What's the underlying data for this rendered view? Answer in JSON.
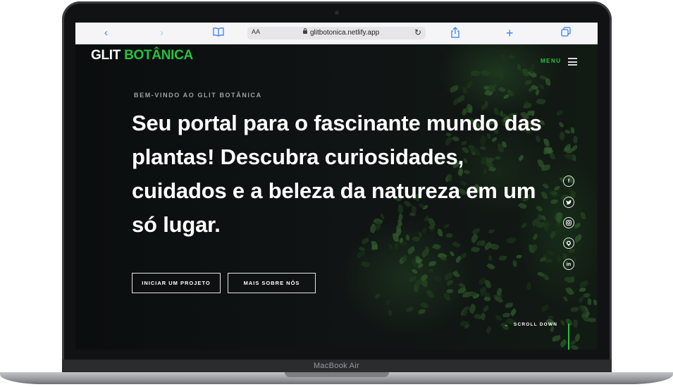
{
  "device": {
    "label": "MacBook Air"
  },
  "browser": {
    "url": "glitbotonica.netlify.app",
    "text_size_label": "AA",
    "icons": [
      "back-icon",
      "forward-icon",
      "bookmarks-icon",
      "reload-icon",
      "share-icon",
      "new-tab-icon",
      "tabs-icon"
    ]
  },
  "site": {
    "brand_main": "GLIT",
    "brand_accent": "BOTÂNICA",
    "menu_label": "MENU",
    "eyebrow": "BEM-VINDO AO GLIT BOTÂNICA",
    "headline": "Seu portal para o fascinante mundo das plantas! Descubra curiosidades, cuidados e a beleza da natureza em um só lugar.",
    "buttons": {
      "primary": "INICIAR UM PROJETO",
      "secondary": "MAIS SOBRE NÓS"
    },
    "social": [
      "facebook",
      "twitter",
      "instagram",
      "github",
      "linkedin"
    ],
    "scroll_label": "SCROLL DOWN"
  },
  "colors": {
    "accent": "#23c33d",
    "background": "#0c0e0e",
    "text": "#ffffff",
    "browser_blue": "#3a80f6"
  }
}
